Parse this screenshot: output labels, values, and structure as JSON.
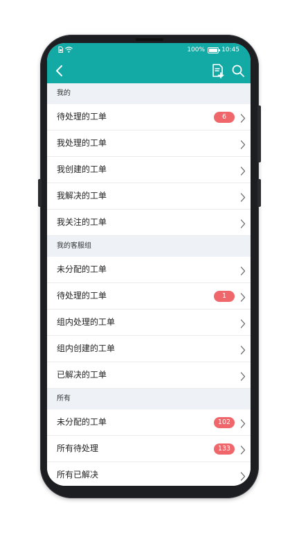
{
  "status_bar": {
    "battery_percent": "100%",
    "time": "10:45",
    "battery_level": 1.0
  },
  "header": {
    "back_icon": "chevron-left-icon",
    "doc_icon": "document-add-icon",
    "search_icon": "search-icon"
  },
  "colors": {
    "header_bg": "#13aaa6",
    "section_bg": "#eef2f7",
    "badge": "#f0676b"
  },
  "sections": [
    {
      "title": "我的",
      "items": [
        {
          "label": "待处理的工单",
          "badge": "6"
        },
        {
          "label": "我处理的工单",
          "badge": ""
        },
        {
          "label": "我创建的工单",
          "badge": ""
        },
        {
          "label": "我解决的工单",
          "badge": ""
        },
        {
          "label": "我关注的工单",
          "badge": ""
        }
      ]
    },
    {
      "title": "我的客服组",
      "items": [
        {
          "label": "未分配的工单",
          "badge": ""
        },
        {
          "label": "待处理的工单",
          "badge": "1"
        },
        {
          "label": "组内处理的工单",
          "badge": ""
        },
        {
          "label": "组内创建的工单",
          "badge": ""
        },
        {
          "label": "已解决的工单",
          "badge": ""
        }
      ]
    },
    {
      "title": "所有",
      "items": [
        {
          "label": "未分配的工单",
          "badge": "102"
        },
        {
          "label": "所有待处理",
          "badge": "133"
        },
        {
          "label": "所有已解决",
          "badge": ""
        }
      ]
    }
  ]
}
